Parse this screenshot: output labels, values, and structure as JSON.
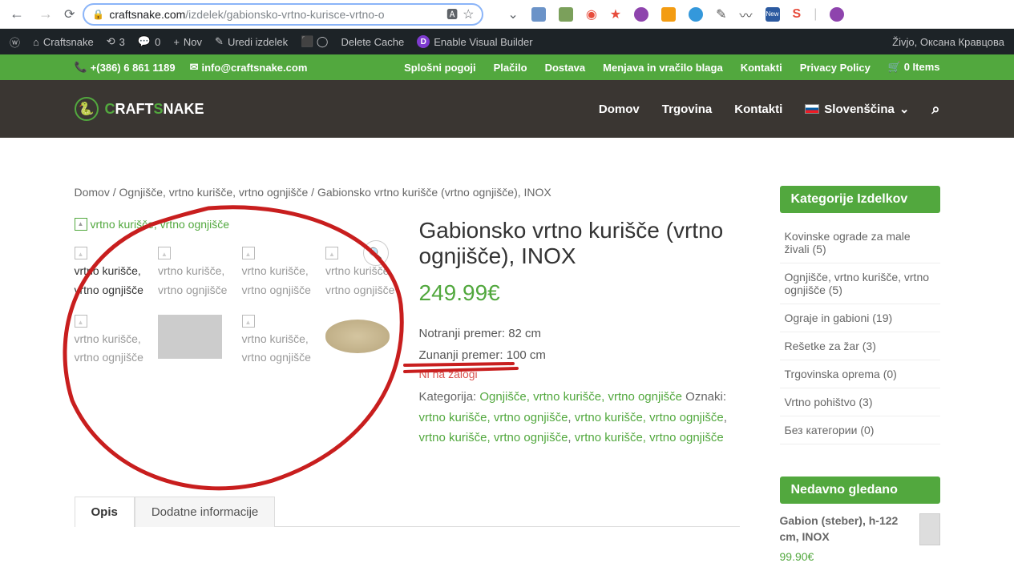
{
  "browser": {
    "url_host": "craftsnake.com",
    "url_path": "/izdelek/gabionsko-vrtno-kurisce-vrtno-o"
  },
  "wp_bar": {
    "site": "Craftsnake",
    "refresh_count": "3",
    "comments": "0",
    "new": "Nov",
    "edit": "Uredi izdelek",
    "cache": "Delete Cache",
    "divi": "Enable Visual Builder",
    "greeting": "Živjo, Оксана Кравцова"
  },
  "topbar": {
    "phone": "+(386) 6 861 1189",
    "email": "info@craftsnake.com",
    "links": [
      "Splošni pogoji",
      "Plačilo",
      "Dostava",
      "Menjava in vračilo blaga",
      "Kontakti",
      "Privacy Policy"
    ],
    "cart": "0 Items"
  },
  "nav": {
    "brand_pre": "C",
    "brand_mid": "RAFT",
    "brand_accent": "S",
    "brand_end": "NAKE",
    "items": [
      "Domov",
      "Trgovina",
      "Kontakti"
    ],
    "lang": "Slovenščina"
  },
  "breadcrumb": {
    "a": "Domov",
    "b": "Ognjišče, vrtno kurišče, vrtno ognjišče",
    "c": "Gabionsko vrtno kurišče (vrtno ognjišče), INOX"
  },
  "gallery": {
    "alt": "vrtno kurišče, vrtno ognjišče",
    "thumb_alt": "vrtno kurišče, vrtno ognjišče"
  },
  "product": {
    "title": "Gabionsko vrtno kurišče (vrtno ognjišče), INOX",
    "price": "249.99€",
    "spec1": "Notranji premer: 82 cm",
    "spec2": "Zunanji premer: 100 cm",
    "stock": "Ni na zalogi",
    "cat_label": "Kategorija:",
    "cat_link": "Ognjišče, vrtno kurišče, vrtno ognjišče",
    "tag_label": "Oznaki:",
    "tag1": "vrtno kurišče, vrtno ognjišče",
    "tag2": "vrtno kurišče, vrtno ognjišče",
    "tag3": "vrtno kurišče, vrtno ognjišče",
    "tag4": "vrtno kurišče, vrtno ognjišče"
  },
  "tabs": {
    "opis": "Opis",
    "dodatne": "Dodatne informacije"
  },
  "sidebar": {
    "cat_title": "Kategorije Izdelkov",
    "cats": [
      {
        "name": "Kovinske ograde za male živali",
        "count": "(5)"
      },
      {
        "name": "Ognjišče, vrtno kurišče, vrtno ognjišče",
        "count": "(5)"
      },
      {
        "name": "Ograje in gabioni",
        "count": "(19)"
      },
      {
        "name": "Rešetke za žar",
        "count": "(3)"
      },
      {
        "name": "Trgovinska oprema",
        "count": "(0)"
      },
      {
        "name": "Vrtno pohištvo",
        "count": "(3)"
      },
      {
        "name": "Без категории",
        "count": "(0)"
      }
    ],
    "recent_title": "Nedavno gledano",
    "recent_name": "Gabion (steber), h-122 cm, INOX",
    "recent_price": "99.90€"
  }
}
